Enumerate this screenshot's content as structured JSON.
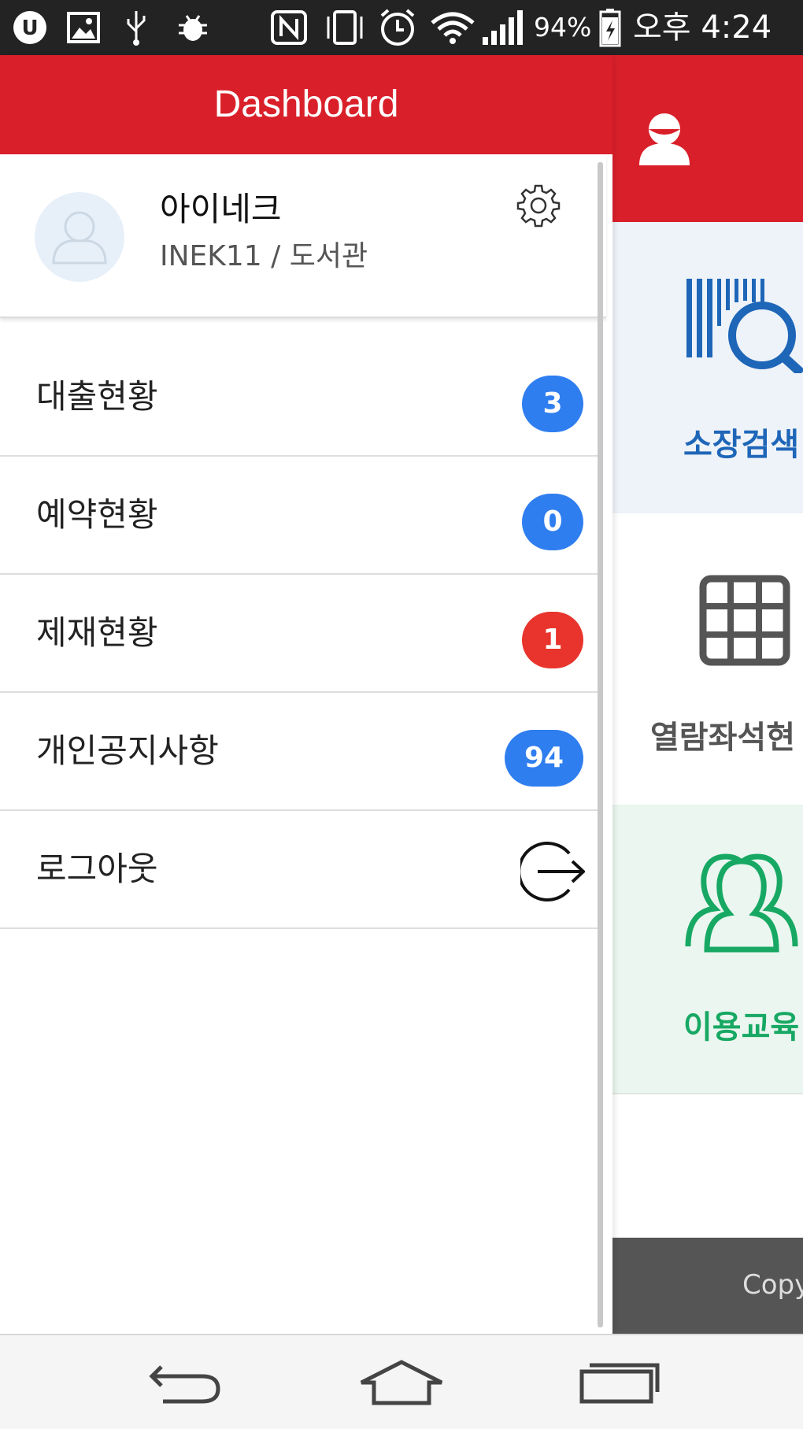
{
  "status_bar": {
    "battery_percent": "94%",
    "time": "오후 4:24",
    "icons": [
      "uplus-icon",
      "image-icon",
      "usb-icon",
      "android-debug-icon",
      "nfc-icon",
      "vibrate-icon",
      "alarm-icon",
      "wifi-icon",
      "signal-icon",
      "battery-charging-icon"
    ]
  },
  "drawer": {
    "title": "Dashboard",
    "profile": {
      "name": "아이네크",
      "subtitle": "INEK11 / 도서관",
      "avatar_icon": "user-placeholder-icon",
      "settings_icon": "gear-icon"
    },
    "menu": [
      {
        "label": "대출현황",
        "badge": "3",
        "badge_color": "#2f7ef0"
      },
      {
        "label": "예약현황",
        "badge": "0",
        "badge_color": "#2f7ef0"
      },
      {
        "label": "제재현황",
        "badge": "1",
        "badge_color": "#e8342c"
      },
      {
        "label": "개인공지사항",
        "badge": "94",
        "badge_color": "#2f7ef0"
      },
      {
        "label": "로그아웃",
        "icon": "logout-icon"
      }
    ]
  },
  "background_app": {
    "header_icon": "user-icon",
    "tiles": [
      {
        "label": "소장검색",
        "icon": "barcode-search-icon",
        "color": "#1e66b8"
      },
      {
        "label": "열람좌석현",
        "icon": "grid-icon",
        "color": "#555555"
      },
      {
        "label": "이용교육",
        "icon": "group-icon",
        "color": "#17a863"
      }
    ],
    "footer_text": "Copy"
  },
  "nav_bar": {
    "icons": [
      "back-icon",
      "home-icon",
      "recent-apps-icon"
    ]
  },
  "colors": {
    "brand_red": "#d9202a",
    "badge_blue": "#2f7ef0",
    "badge_red": "#e8342c"
  }
}
